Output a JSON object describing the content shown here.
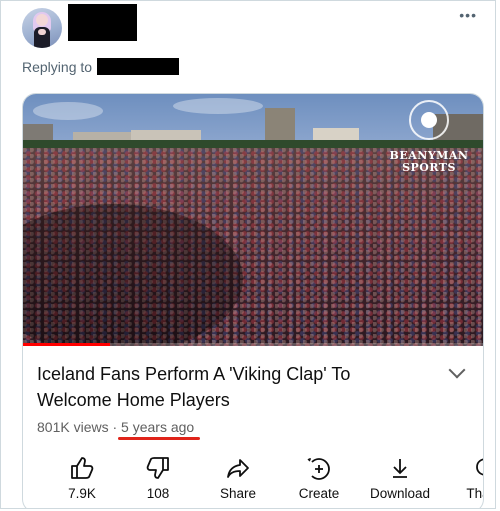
{
  "tweet": {
    "reply_prefix": "Replying to ",
    "reply_at": "@",
    "more_icon": "more-dots-icon"
  },
  "video": {
    "watermark": "BEANYMAN\nSPORTS",
    "progress_fraction": 0.19
  },
  "details": {
    "title": "Iceland Fans Perform A 'Viking Clap' To Welcome Home Players",
    "views": "801K views",
    "separator": " · ",
    "age": "5 years ago",
    "highlight_color": "#e0241a"
  },
  "actions": [
    {
      "icon": "thumbs-up-icon",
      "label": "7.9K"
    },
    {
      "icon": "thumbs-down-icon",
      "label": "108"
    },
    {
      "icon": "share-icon",
      "label": "Share"
    },
    {
      "icon": "create-icon",
      "label": "Create"
    },
    {
      "icon": "download-icon",
      "label": "Download"
    },
    {
      "icon": "thanks-icon",
      "label": "Tha"
    }
  ]
}
